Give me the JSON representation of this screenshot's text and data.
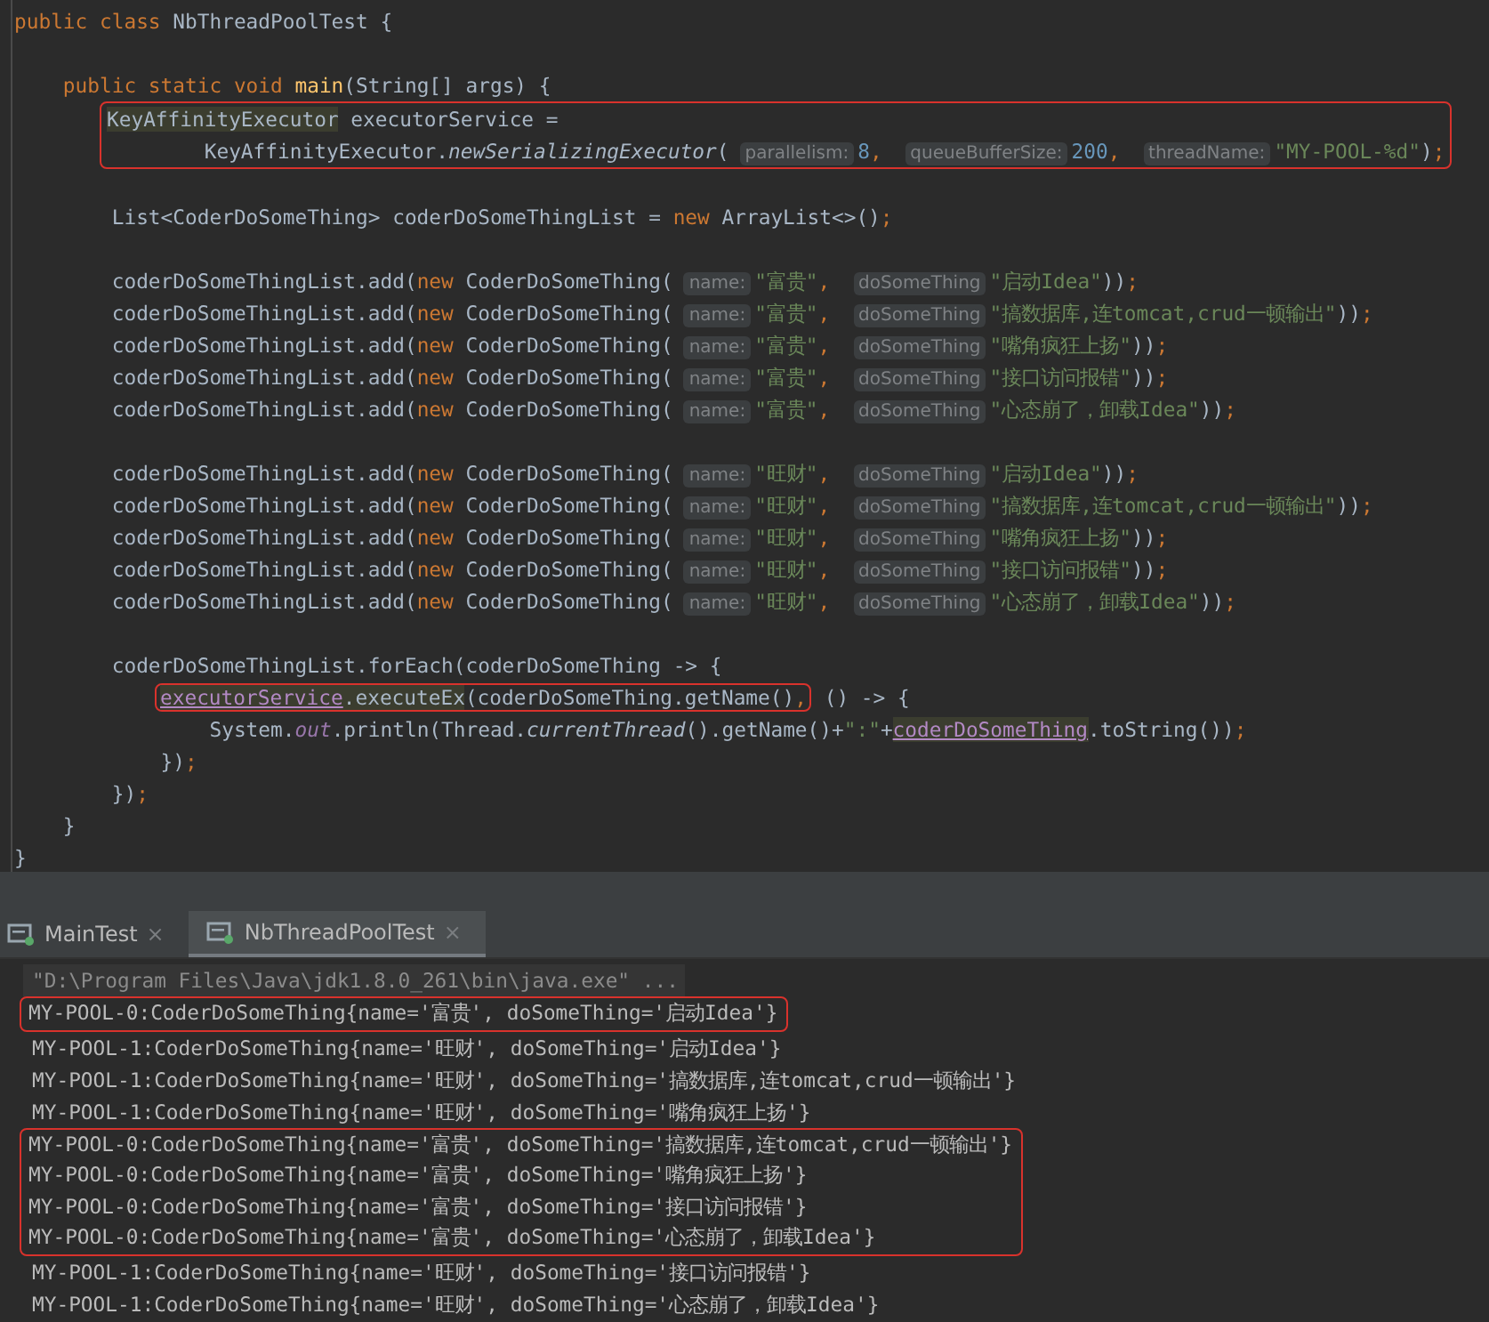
{
  "editor": {
    "lines": [
      {
        "kind": "line",
        "tokens": [
          {
            "kind": "keyword",
            "text": "public class "
          },
          {
            "kind": "plain",
            "text": "NbThreadPoolTest {"
          }
        ]
      },
      {
        "kind": "blank"
      },
      {
        "kind": "line",
        "tokens": [
          {
            "kind": "keyword",
            "text": "    public static void "
          },
          {
            "kind": "declaration",
            "text": "main"
          },
          {
            "kind": "plain",
            "text": "(String[] args) {"
          }
        ]
      },
      {
        "kind": "boxed",
        "lines": [
          {
            "kind": "line",
            "tokens": [
              {
                "kind": "highlight",
                "text": "KeyAffinityExecutor"
              },
              {
                "kind": "plain",
                "text": " executorService ="
              }
            ]
          },
          {
            "kind": "line",
            "tokens": [
              {
                "kind": "plain",
                "text": "        KeyAffinityExecutor."
              },
              {
                "kind": "italic",
                "text": "newSerializingExecutor"
              },
              {
                "kind": "plain",
                "text": "("
              },
              {
                "kind": "hint",
                "text": "parallelism:"
              },
              {
                "kind": "number",
                "text": "8"
              },
              {
                "kind": "punct",
                "text": ", "
              },
              {
                "kind": "hint",
                "text": "queueBufferSize:"
              },
              {
                "kind": "number",
                "text": "200"
              },
              {
                "kind": "punct",
                "text": ", "
              },
              {
                "kind": "hint",
                "text": "threadName:"
              },
              {
                "kind": "string",
                "text": "\"MY-POOL-%d\""
              },
              {
                "kind": "plain",
                "text": ")"
              },
              {
                "kind": "punct",
                "text": ";"
              }
            ]
          }
        ]
      },
      {
        "kind": "blank"
      },
      {
        "kind": "line",
        "tokens": [
          {
            "kind": "plain",
            "text": "        List<CoderDoSomeThing> coderDoSomeThingList = "
          },
          {
            "kind": "keyword",
            "text": "new"
          },
          {
            "kind": "plain",
            "text": " ArrayList<>()"
          },
          {
            "kind": "punct",
            "text": ";"
          }
        ]
      },
      {
        "kind": "blank"
      },
      {
        "kind": "line",
        "tokens": [
          {
            "kind": "plain",
            "text": "        coderDoSomeThingList.add("
          },
          {
            "kind": "keyword",
            "text": "new"
          },
          {
            "kind": "plain",
            "text": " CoderDoSomeThing("
          },
          {
            "kind": "hint",
            "text": "name:"
          },
          {
            "kind": "string",
            "text": "\"富贵\""
          },
          {
            "kind": "punct",
            "text": ", "
          },
          {
            "kind": "hint",
            "text": "doSomeThing"
          },
          {
            "kind": "string",
            "text": "\"启动Idea\""
          },
          {
            "kind": "plain",
            "text": "))"
          },
          {
            "kind": "punct",
            "text": ";"
          }
        ]
      },
      {
        "kind": "line",
        "tokens": [
          {
            "kind": "plain",
            "text": "        coderDoSomeThingList.add("
          },
          {
            "kind": "keyword",
            "text": "new"
          },
          {
            "kind": "plain",
            "text": " CoderDoSomeThing("
          },
          {
            "kind": "hint",
            "text": "name:"
          },
          {
            "kind": "string",
            "text": "\"富贵\""
          },
          {
            "kind": "punct",
            "text": ", "
          },
          {
            "kind": "hint",
            "text": "doSomeThing"
          },
          {
            "kind": "string",
            "text": "\"搞数据库,连tomcat,crud一顿输出\""
          },
          {
            "kind": "plain",
            "text": "))"
          },
          {
            "kind": "punct",
            "text": ";"
          }
        ]
      },
      {
        "kind": "line",
        "tokens": [
          {
            "kind": "plain",
            "text": "        coderDoSomeThingList.add("
          },
          {
            "kind": "keyword",
            "text": "new"
          },
          {
            "kind": "plain",
            "text": " CoderDoSomeThing("
          },
          {
            "kind": "hint",
            "text": "name:"
          },
          {
            "kind": "string",
            "text": "\"富贵\""
          },
          {
            "kind": "punct",
            "text": ", "
          },
          {
            "kind": "hint",
            "text": "doSomeThing"
          },
          {
            "kind": "string",
            "text": "\"嘴角疯狂上扬\""
          },
          {
            "kind": "plain",
            "text": "))"
          },
          {
            "kind": "punct",
            "text": ";"
          }
        ]
      },
      {
        "kind": "line",
        "tokens": [
          {
            "kind": "plain",
            "text": "        coderDoSomeThingList.add("
          },
          {
            "kind": "keyword",
            "text": "new"
          },
          {
            "kind": "plain",
            "text": " CoderDoSomeThing("
          },
          {
            "kind": "hint",
            "text": "name:"
          },
          {
            "kind": "string",
            "text": "\"富贵\""
          },
          {
            "kind": "punct",
            "text": ", "
          },
          {
            "kind": "hint",
            "text": "doSomeThing"
          },
          {
            "kind": "string",
            "text": "\"接口访问报错\""
          },
          {
            "kind": "plain",
            "text": "))"
          },
          {
            "kind": "punct",
            "text": ";"
          }
        ]
      },
      {
        "kind": "line",
        "tokens": [
          {
            "kind": "plain",
            "text": "        coderDoSomeThingList.add("
          },
          {
            "kind": "keyword",
            "text": "new"
          },
          {
            "kind": "plain",
            "text": " CoderDoSomeThing("
          },
          {
            "kind": "hint",
            "text": "name:"
          },
          {
            "kind": "string",
            "text": "\"富贵\""
          },
          {
            "kind": "punct",
            "text": ", "
          },
          {
            "kind": "hint",
            "text": "doSomeThing"
          },
          {
            "kind": "string",
            "text": "\"心态崩了，卸载Idea\""
          },
          {
            "kind": "plain",
            "text": "))"
          },
          {
            "kind": "punct",
            "text": ";"
          }
        ]
      },
      {
        "kind": "blank"
      },
      {
        "kind": "line",
        "tokens": [
          {
            "kind": "plain",
            "text": "        coderDoSomeThingList.add("
          },
          {
            "kind": "keyword",
            "text": "new"
          },
          {
            "kind": "plain",
            "text": " CoderDoSomeThing("
          },
          {
            "kind": "hint",
            "text": "name:"
          },
          {
            "kind": "string",
            "text": "\"旺财\""
          },
          {
            "kind": "punct",
            "text": ", "
          },
          {
            "kind": "hint",
            "text": "doSomeThing"
          },
          {
            "kind": "string",
            "text": "\"启动Idea\""
          },
          {
            "kind": "plain",
            "text": "))"
          },
          {
            "kind": "punct",
            "text": ";"
          }
        ]
      },
      {
        "kind": "line",
        "tokens": [
          {
            "kind": "plain",
            "text": "        coderDoSomeThingList.add("
          },
          {
            "kind": "keyword",
            "text": "new"
          },
          {
            "kind": "plain",
            "text": " CoderDoSomeThing("
          },
          {
            "kind": "hint",
            "text": "name:"
          },
          {
            "kind": "string",
            "text": "\"旺财\""
          },
          {
            "kind": "punct",
            "text": ", "
          },
          {
            "kind": "hint",
            "text": "doSomeThing"
          },
          {
            "kind": "string",
            "text": "\"搞数据库,连tomcat,crud一顿输出\""
          },
          {
            "kind": "plain",
            "text": "))"
          },
          {
            "kind": "punct",
            "text": ";"
          }
        ]
      },
      {
        "kind": "line",
        "tokens": [
          {
            "kind": "plain",
            "text": "        coderDoSomeThingList.add("
          },
          {
            "kind": "keyword",
            "text": "new"
          },
          {
            "kind": "plain",
            "text": " CoderDoSomeThing("
          },
          {
            "kind": "hint",
            "text": "name:"
          },
          {
            "kind": "string",
            "text": "\"旺财\""
          },
          {
            "kind": "punct",
            "text": ", "
          },
          {
            "kind": "hint",
            "text": "doSomeThing"
          },
          {
            "kind": "string",
            "text": "\"嘴角疯狂上扬\""
          },
          {
            "kind": "plain",
            "text": "))"
          },
          {
            "kind": "punct",
            "text": ";"
          }
        ]
      },
      {
        "kind": "line",
        "tokens": [
          {
            "kind": "plain",
            "text": "        coderDoSomeThingList.add("
          },
          {
            "kind": "keyword",
            "text": "new"
          },
          {
            "kind": "plain",
            "text": " CoderDoSomeThing("
          },
          {
            "kind": "hint",
            "text": "name:"
          },
          {
            "kind": "string",
            "text": "\"旺财\""
          },
          {
            "kind": "punct",
            "text": ", "
          },
          {
            "kind": "hint",
            "text": "doSomeThing"
          },
          {
            "kind": "string",
            "text": "\"接口访问报错\""
          },
          {
            "kind": "plain",
            "text": "))"
          },
          {
            "kind": "punct",
            "text": ";"
          }
        ]
      },
      {
        "kind": "line",
        "tokens": [
          {
            "kind": "plain",
            "text": "        coderDoSomeThingList.add("
          },
          {
            "kind": "keyword",
            "text": "new"
          },
          {
            "kind": "plain",
            "text": " CoderDoSomeThing("
          },
          {
            "kind": "hint",
            "text": "name:"
          },
          {
            "kind": "string",
            "text": "\"旺财\""
          },
          {
            "kind": "punct",
            "text": ", "
          },
          {
            "kind": "hint",
            "text": "doSomeThing"
          },
          {
            "kind": "string",
            "text": "\"心态崩了，卸载Idea\""
          },
          {
            "kind": "plain",
            "text": "))"
          },
          {
            "kind": "punct",
            "text": ";"
          }
        ]
      },
      {
        "kind": "blank"
      },
      {
        "kind": "line",
        "tokens": [
          {
            "kind": "plain",
            "text": "        coderDoSomeThingList.forEach(coderDoSomeThing -> {"
          }
        ]
      },
      {
        "kind": "line",
        "tokens": [
          {
            "kind": "box",
            "tokens": [
              {
                "kind": "underline",
                "text": "executorService"
              },
              {
                "kind": "highlight",
                "text": ".executeEx"
              },
              {
                "kind": "plain",
                "text": "(coderDoSomeThing.getName()"
              },
              {
                "kind": "punct",
                "text": ","
              }
            ]
          },
          {
            "kind": "plain",
            "text": " () -> {"
          }
        ]
      },
      {
        "kind": "line",
        "tokens": [
          {
            "kind": "plain",
            "text": "                System."
          },
          {
            "kind": "field",
            "text": "out"
          },
          {
            "kind": "plain",
            "text": ".println(Thread."
          },
          {
            "kind": "italic",
            "text": "currentThread"
          },
          {
            "kind": "plain",
            "text": "().getName()+"
          },
          {
            "kind": "string",
            "text": "\":\""
          },
          {
            "kind": "plain",
            "text": "+"
          },
          {
            "kind": "underline",
            "text": "coderDoSomeThing"
          },
          {
            "kind": "plain",
            "text": ".toString())"
          },
          {
            "kind": "punct",
            "text": ";"
          }
        ]
      },
      {
        "kind": "line",
        "tokens": [
          {
            "kind": "plain",
            "text": "            })"
          },
          {
            "kind": "punct",
            "text": ";"
          }
        ]
      },
      {
        "kind": "line",
        "tokens": [
          {
            "kind": "plain",
            "text": "        })"
          },
          {
            "kind": "punct",
            "text": ";"
          }
        ]
      },
      {
        "kind": "line",
        "tokens": [
          {
            "kind": "plain",
            "text": "    }"
          }
        ]
      },
      {
        "kind": "line",
        "tokens": [
          {
            "kind": "plain",
            "text": "}"
          }
        ]
      }
    ]
  },
  "console": {
    "tabs": [
      {
        "label": "MainTest",
        "close": "×",
        "selected": false
      },
      {
        "label": "NbThreadPoolTest",
        "close": "×",
        "selected": true
      }
    ],
    "output": [
      {
        "kind": "command",
        "text": "\"D:\\Program Files\\Java\\jdk1.8.0_261\\bin\\java.exe\" ..."
      },
      {
        "kind": "boxed",
        "lines": [
          "MY-POOL-0:CoderDoSomeThing{name='富贵', doSomeThing='启动Idea'}"
        ]
      },
      {
        "kind": "line",
        "text": "MY-POOL-1:CoderDoSomeThing{name='旺财', doSomeThing='启动Idea'}"
      },
      {
        "kind": "line",
        "text": "MY-POOL-1:CoderDoSomeThing{name='旺财', doSomeThing='搞数据库,连tomcat,crud一顿输出'}"
      },
      {
        "kind": "line",
        "text": "MY-POOL-1:CoderDoSomeThing{name='旺财', doSomeThing='嘴角疯狂上扬'}"
      },
      {
        "kind": "boxed",
        "lines": [
          "MY-POOL-0:CoderDoSomeThing{name='富贵', doSomeThing='搞数据库,连tomcat,crud一顿输出'}",
          "MY-POOL-0:CoderDoSomeThing{name='富贵', doSomeThing='嘴角疯狂上扬'}",
          "MY-POOL-0:CoderDoSomeThing{name='富贵', doSomeThing='接口访问报错'}",
          "MY-POOL-0:CoderDoSomeThing{name='富贵', doSomeThing='心态崩了，卸载Idea'}"
        ]
      },
      {
        "kind": "line",
        "text": "MY-POOL-1:CoderDoSomeThing{name='旺财', doSomeThing='接口访问报错'}"
      },
      {
        "kind": "line",
        "text": "MY-POOL-1:CoderDoSomeThing{name='旺财', doSomeThing='心态崩了，卸载Idea'}"
      }
    ]
  }
}
